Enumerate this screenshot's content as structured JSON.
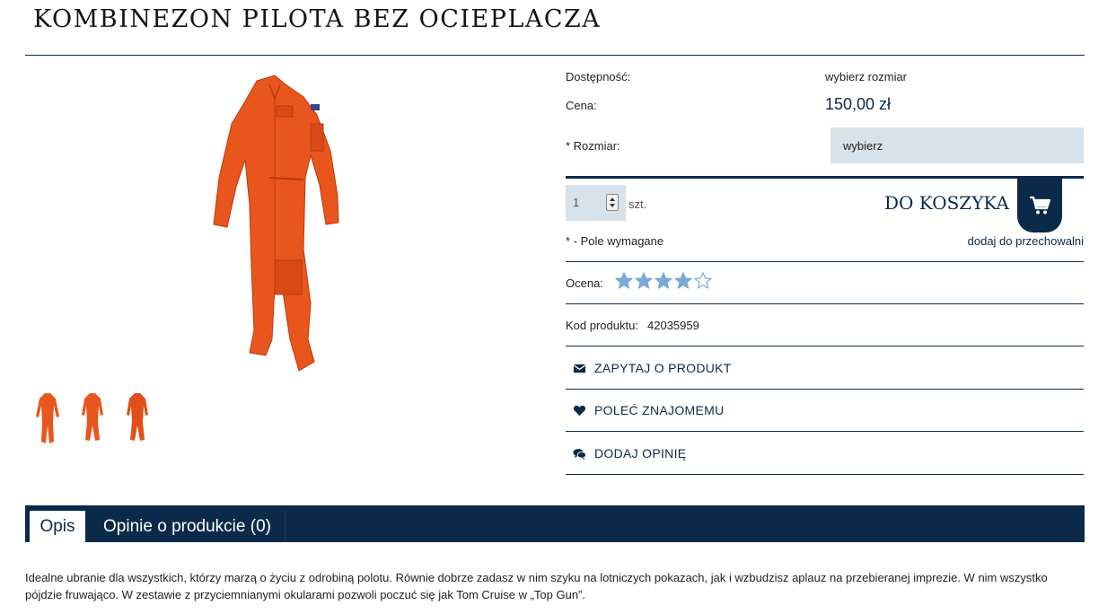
{
  "product": {
    "title": "KOMBINEZON PILOTA BEZ OCIEPLACZA",
    "availability_label": "Dostępność:",
    "availability_value": "wybierz rozmiar",
    "price_label": "Cena:",
    "price_value": "150,00 zł",
    "size_label": "* Rozmiar:",
    "size_selected": "wybierz",
    "quantity": "1",
    "quantity_unit": "szt.",
    "add_to_cart": "DO KOSZYKA",
    "required_note": "* - Pole wymagane",
    "stash_link": "dodaj do przechowalni",
    "rating_label": "Ocena:",
    "rating_value": 4,
    "rating_max": 5,
    "code_label": "Kod produktu:",
    "code_value": "42035959"
  },
  "actions": {
    "ask": "ZAPYTAJ O PRODUKT",
    "recommend": "POLEĆ ZNAJOMEMU",
    "review": "DODAJ OPINIĘ"
  },
  "tabs": {
    "description": "Opis",
    "reviews": "Opinie o produkcie (0)"
  },
  "description": "Idealne ubranie dla wszystkich, którzy marzą o życiu z odrobiną polotu. Równie dobrze zadasz w nim szyku na lotniczych pokazach, jak i wzbudzisz aplauz na przebieranej imprezie. W nim wszystko pójdzie fruwająco. W zestawie z przyciemnianymi okularami pozwoli poczuć się jak Tom Cruise w „Top Gun”.",
  "colors": {
    "navy": "#0b2a4a",
    "field": "#d8e2ea",
    "garment": "#e8561e",
    "star": "#7aa9d6"
  },
  "icons": {
    "cart": "cart-icon",
    "ask": "envelope-icon",
    "recommend": "heart-icon",
    "review": "comments-icon"
  }
}
